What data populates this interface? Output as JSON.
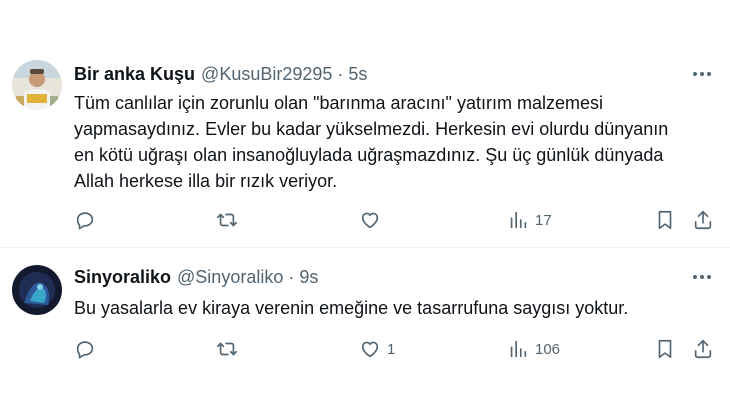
{
  "tweets": [
    {
      "name": "Bir anka Kuşu",
      "handle": "@KusuBir29295",
      "separator": "·",
      "time": "5s",
      "text": "Tüm canlılar için zorunlu olan \"barınma aracını\" yatırım malzemesi\nyapmasaydınız. Evler bu kadar yükselmezdi. Herkesin evi olurdu dünyanın\nen kötü uğraşı olan insanoğluylada uğraşmazdınız. Şu üç günlük dünyada\nAllah herkese illa bir rızık veriyor.",
      "reply_count": "",
      "retweet_count": "",
      "like_count": "",
      "view_count": "17"
    },
    {
      "name": "Sinyoraliko",
      "handle": "@Sinyoraliko",
      "separator": "·",
      "time": "9s",
      "text": "Bu yasalarla ev kiraya verenin emeğine ve tasarrufuna saygısı yoktur.",
      "reply_count": "",
      "retweet_count": "",
      "like_count": "1",
      "view_count": "106"
    }
  ],
  "icons": {
    "reply": "reply-icon",
    "retweet": "retweet-icon",
    "like": "heart-icon",
    "views": "views-icon",
    "bookmark": "bookmark-icon",
    "share": "share-icon",
    "more": "more-dots-icon"
  },
  "colors": {
    "text": "#0f1419",
    "secondary": "#536471",
    "divider": "#eff3f4",
    "background": "#ffffff"
  }
}
